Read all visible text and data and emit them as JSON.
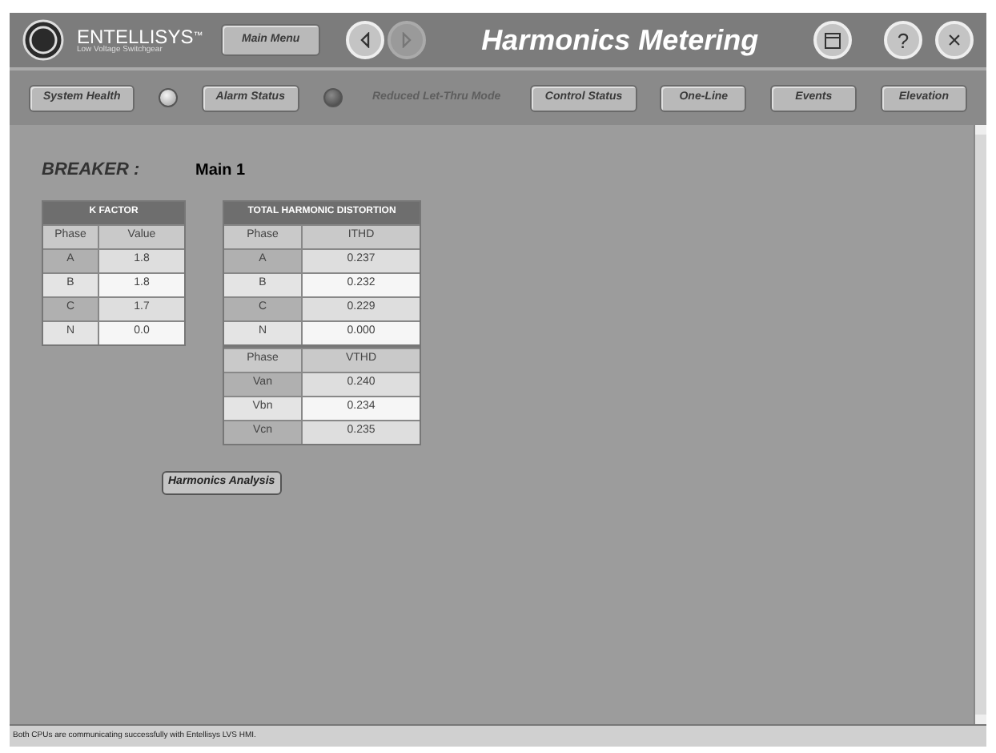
{
  "header": {
    "brand": "ENTELLISYS",
    "trademark": "™",
    "subtitle": "Low Voltage Switchgear",
    "main_menu": "Main Menu",
    "back_enabled": true,
    "forward_enabled": false,
    "title": "Harmonics Metering",
    "help": "?",
    "close": "×"
  },
  "nav": [
    {
      "kind": "button",
      "label": "System Health"
    },
    {
      "kind": "led",
      "on": true
    },
    {
      "kind": "button",
      "label": "Alarm Status"
    },
    {
      "kind": "led",
      "on": false
    },
    {
      "kind": "label",
      "label": "Reduced Let-Thru Mode"
    },
    {
      "kind": "button",
      "label": "Control Status"
    },
    {
      "kind": "button",
      "label": "One-Line"
    },
    {
      "kind": "button",
      "label": "Events"
    },
    {
      "kind": "button",
      "label": "Elevation"
    }
  ],
  "breaker": {
    "label": "BREAKER :",
    "value": "Main 1"
  },
  "kfactor": {
    "title": "K FACTOR",
    "columns": [
      "Phase",
      "Value"
    ],
    "rows": [
      [
        "A",
        "1.8"
      ],
      [
        "B",
        "1.8"
      ],
      [
        "C",
        "1.7"
      ],
      [
        "N",
        "0.0"
      ]
    ]
  },
  "thd": {
    "title": "TOTAL HARMONIC DISTORTION",
    "sections": [
      {
        "columns": [
          "Phase",
          "ITHD"
        ],
        "rows": [
          [
            "A",
            "0.237"
          ],
          [
            "B",
            "0.232"
          ],
          [
            "C",
            "0.229"
          ],
          [
            "N",
            "0.000"
          ]
        ]
      },
      {
        "columns": [
          "Phase",
          "VTHD"
        ],
        "rows": [
          [
            "Van",
            "0.240"
          ],
          [
            "Vbn",
            "0.234"
          ],
          [
            "Vcn",
            "0.235"
          ]
        ]
      }
    ]
  },
  "analysis_button": "Harmonics Analysis",
  "status_bar": "Both CPUs are communicating successfully with Entellisys LVS HMI."
}
